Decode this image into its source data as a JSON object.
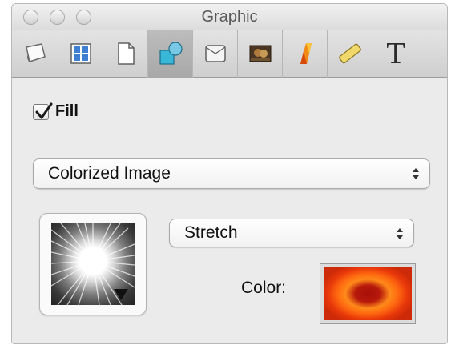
{
  "window": {
    "title": "Graphic"
  },
  "toolbar": {
    "tools": [
      {
        "icon": "canvas-icon"
      },
      {
        "icon": "grid-icon"
      },
      {
        "icon": "document-icon"
      },
      {
        "icon": "shapes-icon",
        "active": true
      },
      {
        "icon": "note-icon"
      },
      {
        "icon": "image-icon"
      },
      {
        "icon": "shadow-icon"
      },
      {
        "icon": "ruler-icon"
      },
      {
        "icon": "text-icon",
        "glyph": "T"
      }
    ]
  },
  "fill": {
    "label": "Fill",
    "checked": true,
    "type_selected": "Colorized Image",
    "scale_selected": "Stretch",
    "color_label": "Color:",
    "accent": "#e8500c"
  }
}
